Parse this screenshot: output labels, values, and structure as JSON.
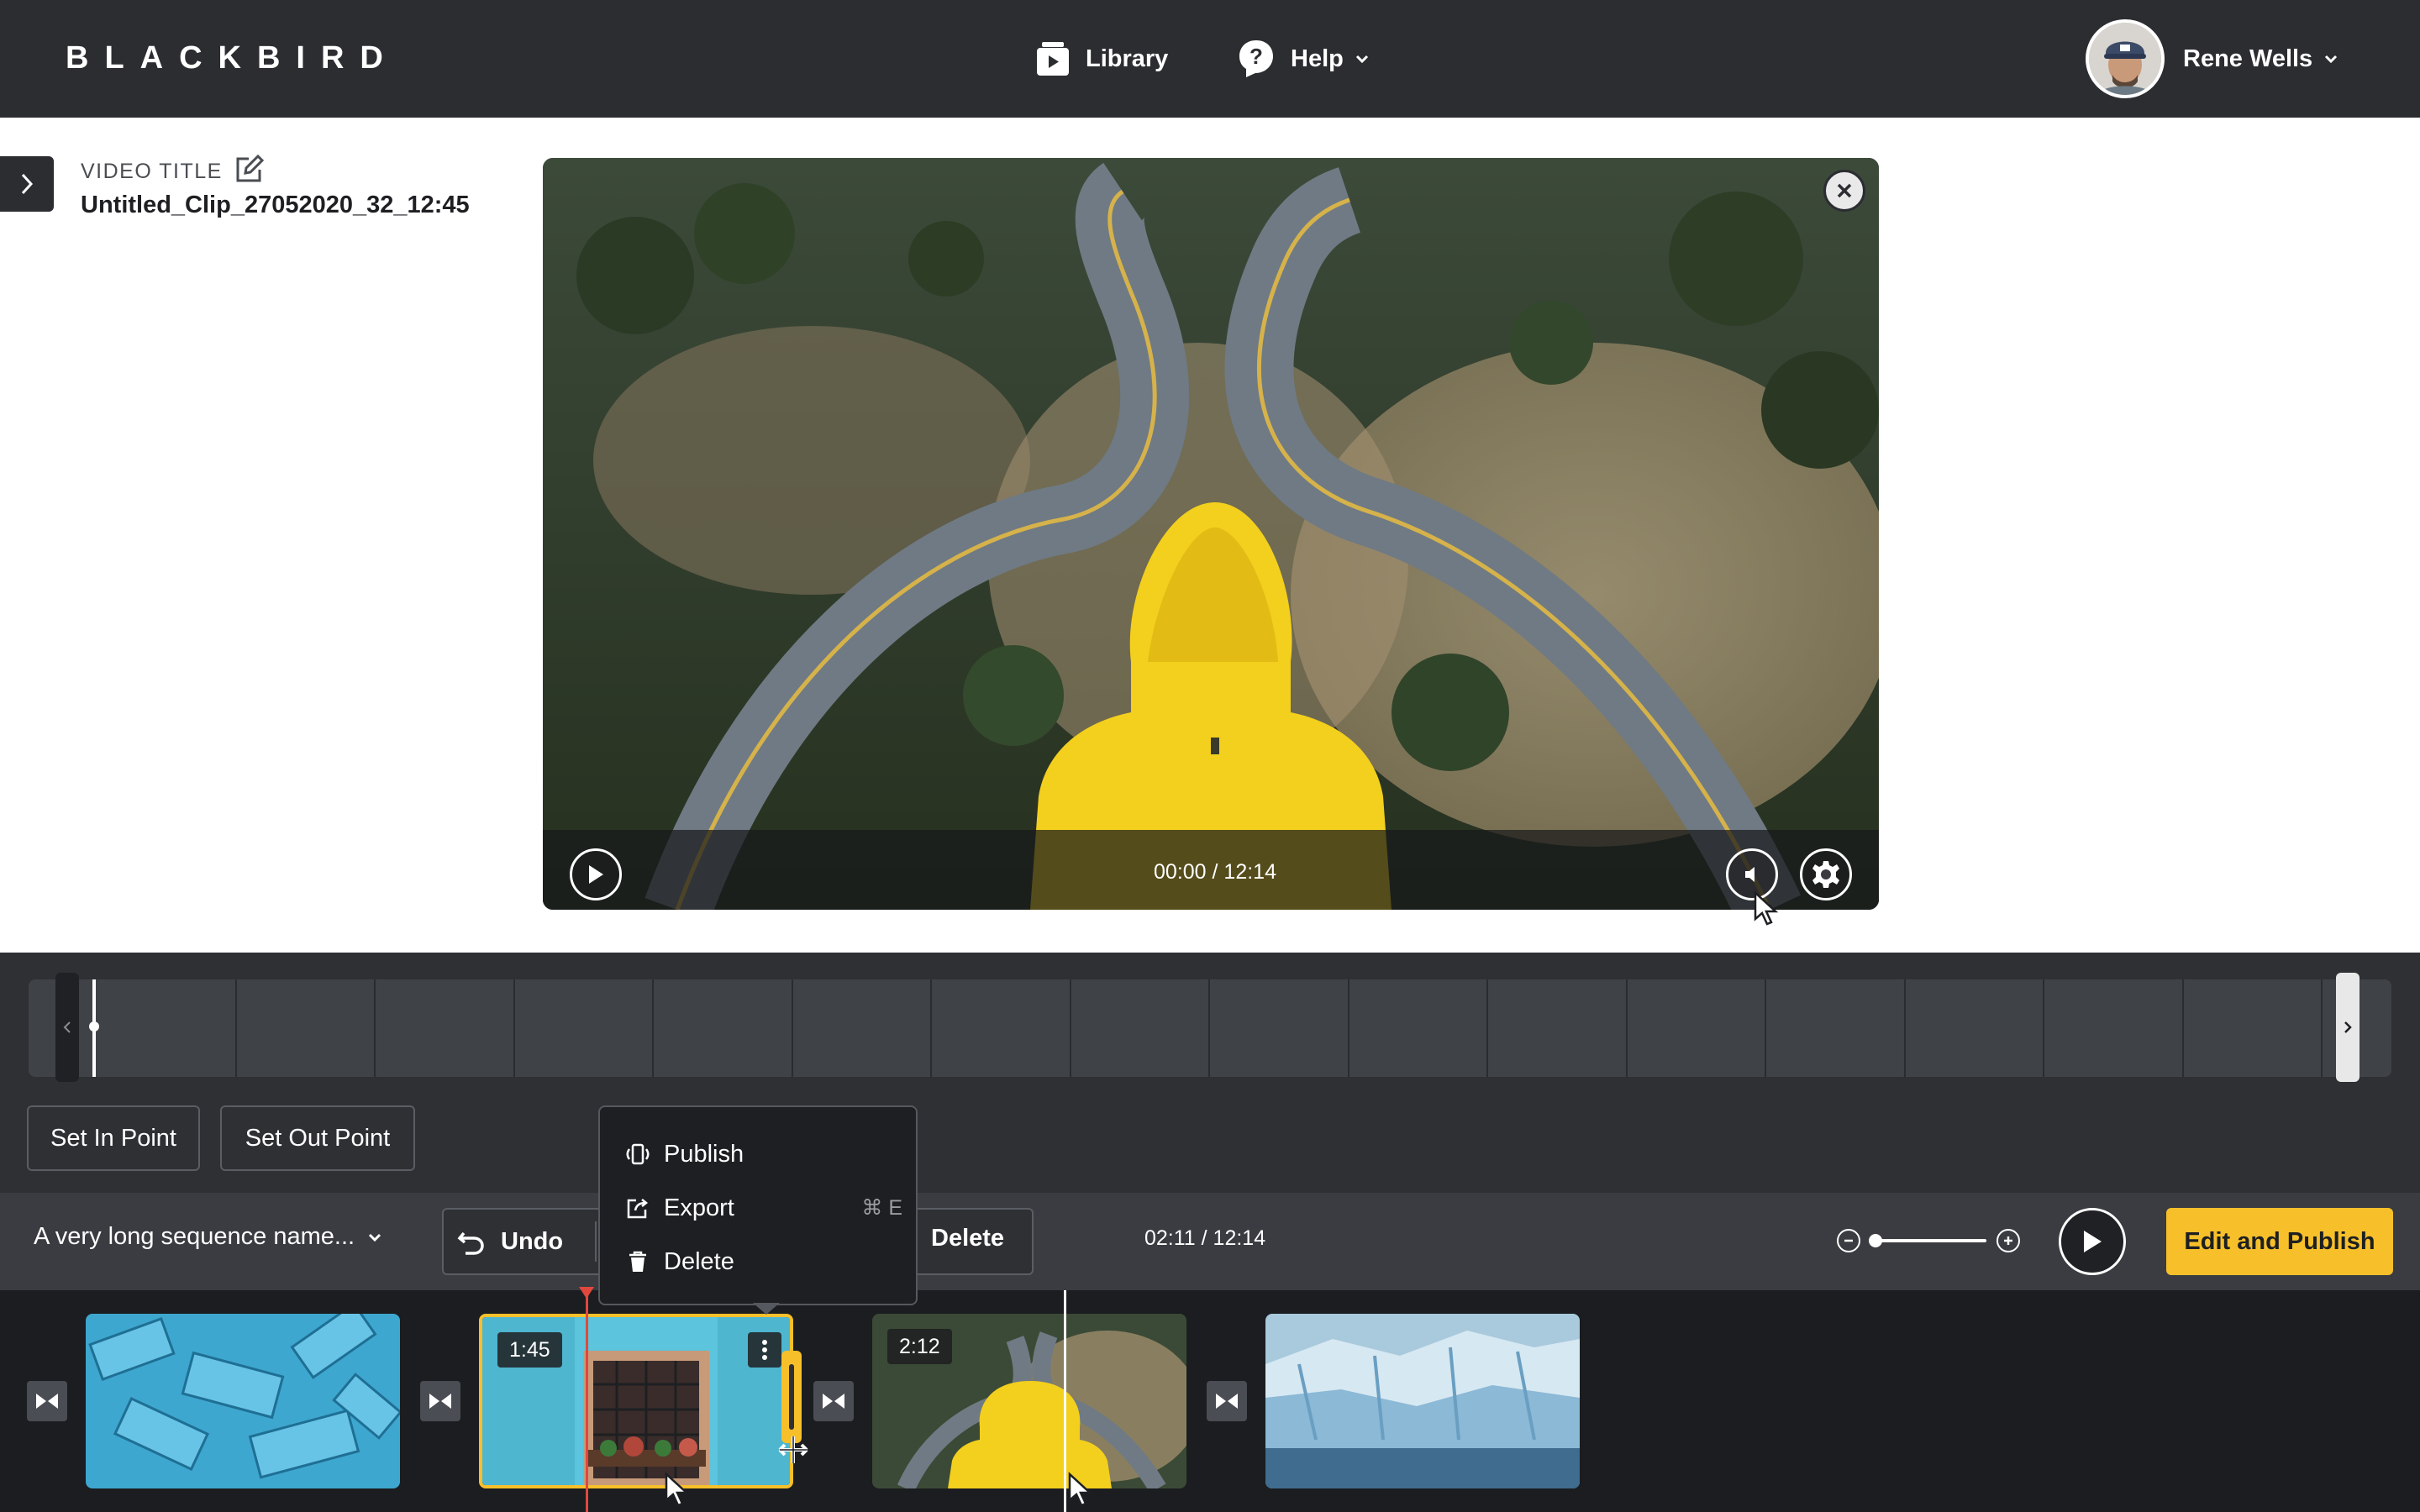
{
  "header": {
    "logo": "BLACKBIRD",
    "nav": [
      {
        "label": "Library",
        "icon": "library-icon"
      },
      {
        "label": "Help",
        "icon": "help-icon"
      }
    ],
    "user": {
      "name": "Rene Wells"
    }
  },
  "title_panel": {
    "label": "VIDEO TITLE",
    "value": "Untitled_Clip_27052020_32_12:45"
  },
  "player": {
    "time": "00:00 / 12:14",
    "icons": [
      "close-icon",
      "play-icon",
      "volume-icon",
      "settings-icon"
    ]
  },
  "trim": {
    "set_in_label": "Set In Point",
    "set_out_label": "Set Out Point"
  },
  "toolbar": {
    "sequence_name": "A very long sequence name...",
    "undo_label": "Undo",
    "delete_label": "Delete",
    "time": "02:11 / 12:14",
    "edit_publish_label": "Edit and Publish"
  },
  "context_menu": {
    "items": [
      {
        "label": "Publish",
        "icon": "publish-icon",
        "shortcut": ""
      },
      {
        "label": "Export",
        "icon": "export-icon",
        "shortcut": "⌘ E"
      },
      {
        "label": "Delete",
        "icon": "trash-icon",
        "shortcut": ""
      }
    ]
  },
  "timeline": {
    "clips": [
      {
        "duration": "",
        "thumbnail": "blue-blocks"
      },
      {
        "duration": "1:45",
        "thumbnail": "blue-wall-window",
        "selected": true
      },
      {
        "duration": "2:12",
        "thumbnail": "yellow-hood-road"
      },
      {
        "duration": "",
        "thumbnail": "iceberg"
      }
    ]
  },
  "colors": {
    "accent": "#f7c02a",
    "topbar": "#2b2d31",
    "editor": "#2e3034",
    "timeline": "#1b1d20",
    "playhead": "#e0483d"
  }
}
